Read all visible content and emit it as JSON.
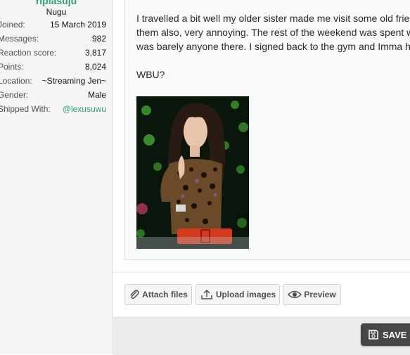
{
  "user": {
    "name": "riplasuju",
    "title": "Nugu",
    "stats": [
      {
        "key": "Joined:",
        "value": "15 March 2019"
      },
      {
        "key": "Messages:",
        "value": "982"
      },
      {
        "key": "Reaction score:",
        "value": "3,817"
      },
      {
        "key": "Points:",
        "value": "8,024"
      },
      {
        "key": "Location:",
        "value": "~Streaming Jen~"
      },
      {
        "key": "Gender:",
        "value": "Male"
      },
      {
        "key": "Shipped With:",
        "value": "@lexusuwu"
      }
    ]
  },
  "post": {
    "paragraph_lines": [
      "I travelled a bit well my older sister made me visit some old friends",
      "them also, very annoying. The rest of the weekend was spent watching",
      "was barely anyone there. I signed back to the gym and Imma hit it"
    ],
    "closing": "WBU?"
  },
  "editor": {
    "attach_label": "Attach files",
    "upload_label": "Upload images",
    "preview_label": "Preview",
    "save_label": "SAVE"
  },
  "colors": {
    "accent": "#2e9e7e",
    "save_bg": "#474747"
  }
}
